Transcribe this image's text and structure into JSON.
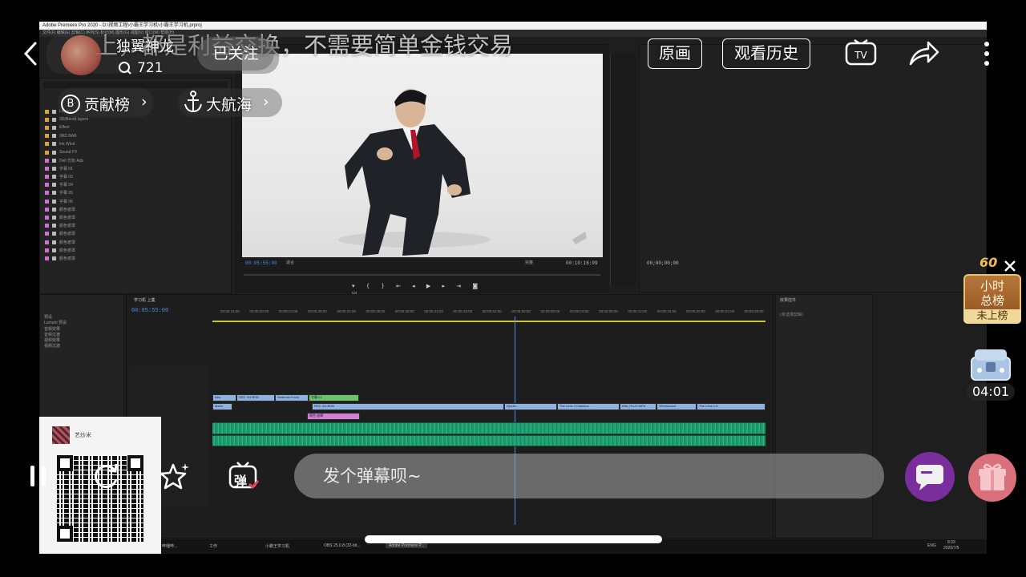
{
  "danmaku_marquee": "上，都是利益交换，不需要简单金钱交易",
  "streamer": {
    "name": "独翼神龙",
    "viewers": "721",
    "follow_label": "已关注"
  },
  "header_buttons": {
    "original_label": "原画",
    "history_label": "观看历史"
  },
  "ranking_links": {
    "contribution_label": "贡献榜",
    "contribution_glyph": "B",
    "voyage_label": "大航海"
  },
  "hour_rank": {
    "badge_number": "60",
    "title_line1": "小时",
    "title_line2": "总榜",
    "status": "未上榜"
  },
  "treasure_timer": "04:01",
  "bottom_bar": {
    "danmaku_toggle_label": "弹",
    "input_placeholder": "发个弹幕呗~"
  },
  "premiere": {
    "window_title": "Adobe Premiere Pro 2020 - D:\\视频工程\\小霸王学习机\\小霸王学习机.prproj",
    "menu": "文件(F)   编辑(E)   剪辑(C)   序列(S)   标记(M)   图形(G)   视图(V)   窗口(W)   帮助(H)",
    "project_rows": [
      "Library",
      "3D(Bend) layers",
      "Effect",
      "3RD BAR",
      "Ink Wind",
      "Sound FX",
      "Dell 光标 Ads",
      "字幕 01",
      "字幕 02",
      "字幕 04",
      "字幕 05",
      "字幕 06",
      "颜色遮罩",
      "颜色遮罩",
      "颜色遮罩",
      "颜色遮罩",
      "颜色遮罩",
      "颜色遮罩",
      "颜色遮罩"
    ],
    "program_timecode": "00:05:55:00",
    "program_duration": "00:10:16:09",
    "fit_label": "适合",
    "full_label": "完整",
    "sequence_timecode": "00:05:55:00",
    "sequence_tab": "学习机 上集",
    "source_timecode": "00;00;00;00",
    "effects_panel_title": "效果控件",
    "effects_panel_note": "(未选择剪辑)",
    "media_browser_items": [
      "预设",
      "Lumetri 预设",
      "音频效果",
      "音频过渡",
      "视频效果",
      "视频过渡"
    ],
    "ruler_labels": [
      "00:05:16:00",
      "00:05:20:00",
      "00:05:24:00",
      "00:05:28:00",
      "00:05:32:00",
      "00:05:36:00",
      "00:05:40:00",
      "00:05:44:00",
      "00:05:48:00",
      "00:05:52:00",
      "00:05:56:00",
      "00:06:00:00",
      "00:06:04:00",
      "00:06:08:00",
      "00:06:12:00",
      "00:06:16:00",
      "00:06:20:00",
      "00:06:24:00",
      "00:06:28:00"
    ],
    "clips_v1": [
      "Mario",
      "RRC 3/4 BOB",
      "Hyrule...",
      "The Lens 3 Kaleidos..",
      "IBM_PLUS.MP4",
      "Yiteresound",
      "The Lens 1.5"
    ],
    "clips_v2": [
      "Nes",
      "RRC 3/4 BOB",
      "Nintendo Exchi",
      "字幕 01"
    ],
    "clip_title": "颜色 遮罩",
    "taskbar_items": [
      "哔哩哔...",
      "工作",
      "小霸王学习机",
      "OBS 25.0.8 (32-bit...",
      "Adobe Premiere P..."
    ],
    "clock_time": "8:33",
    "clock_date": "2020/7/5",
    "ime": "ENG"
  },
  "qr_card": {
    "caption": "艺炒米"
  },
  "colors": {
    "pr_timeline_accent": "#4a8fe0",
    "danmaku_button": "#7a2d9c",
    "gift_button": "#d9707a",
    "rank_badge": "#a8652a"
  }
}
